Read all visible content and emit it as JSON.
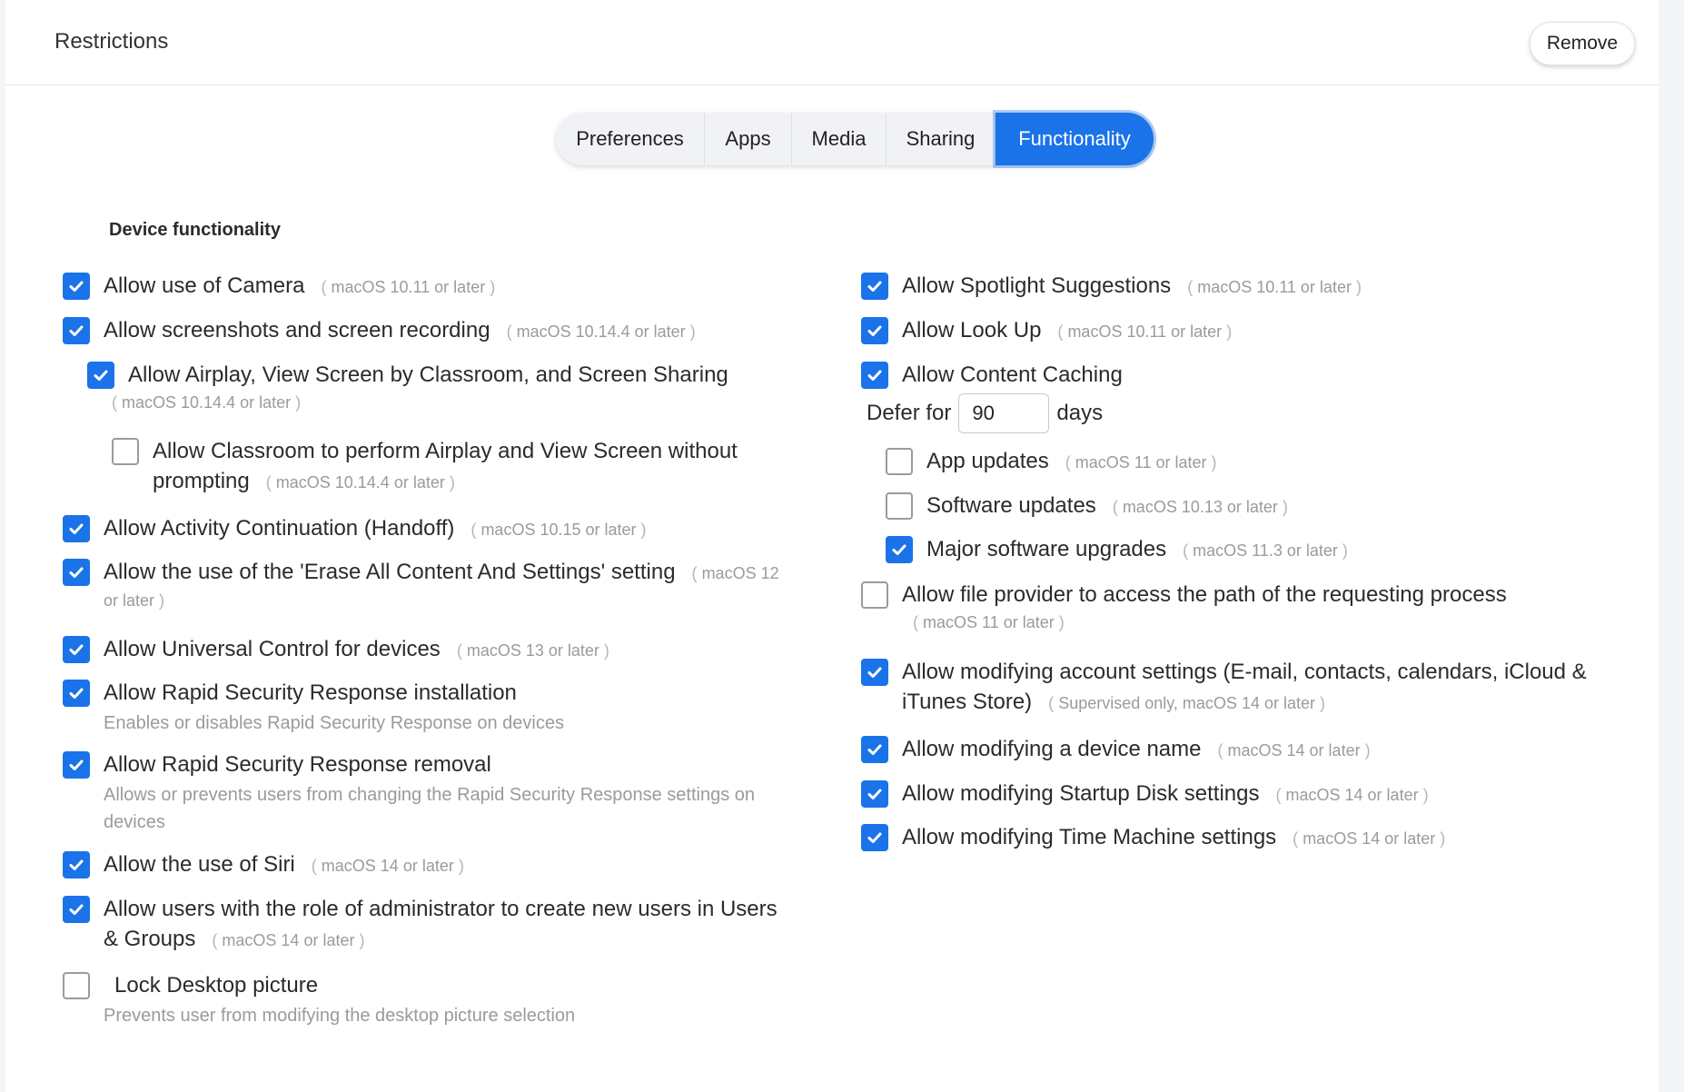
{
  "header": {
    "title": "Restrictions",
    "remove_label": "Remove"
  },
  "tabs": [
    "Preferences",
    "Apps",
    "Media",
    "Sharing",
    "Functionality"
  ],
  "active_tab": "Functionality",
  "section_title": "Device functionality",
  "left": {
    "camera": {
      "label": "Allow use of Camera",
      "req": "macOS 10.11 or later",
      "checked": true
    },
    "screenshots": {
      "label": "Allow screenshots and screen recording",
      "req": "macOS 10.14.4 or later",
      "checked": true
    },
    "airplay": {
      "label": "Allow Airplay, View Screen by Classroom, and Screen Sharing",
      "req": "macOS 10.14.4 or later",
      "checked": true
    },
    "classroom": {
      "label_line1": "Allow Classroom to perform Airplay and View Screen without",
      "label_line2": "prompting",
      "req": "macOS 10.14.4 or later",
      "checked": false
    },
    "handoff": {
      "label": "Allow Activity Continuation (Handoff)",
      "req": "macOS 10.15 or later",
      "checked": true
    },
    "erase": {
      "label": "Allow the use of the 'Erase All Content And Settings' setting",
      "req_part1": "macOS 12",
      "req_part2": "or later",
      "checked": true
    },
    "universal": {
      "label": "Allow Universal Control for devices",
      "req": "macOS 13 or later",
      "checked": true
    },
    "rsr_install": {
      "label": "Allow Rapid Security Response installation",
      "desc": "Enables or disables Rapid Security Response on devices",
      "checked": true
    },
    "rsr_removal": {
      "label": "Allow Rapid Security Response removal",
      "desc_line1": "Allows or prevents users from changing the Rapid Security Response settings on",
      "desc_line2": "devices",
      "checked": true
    },
    "siri": {
      "label": "Allow the use of Siri",
      "req": "macOS 14 or later",
      "checked": true
    },
    "admin_users": {
      "label_line1": "Allow users with the role of administrator to create new users in Users",
      "label_line2": "& Groups",
      "req": "macOS 14 or later",
      "checked": true
    },
    "desktop": {
      "label": "Lock Desktop picture",
      "desc": "Prevents user from modifying the desktop picture selection",
      "checked": false
    }
  },
  "right": {
    "spotlight": {
      "label": "Allow Spotlight Suggestions",
      "req": "macOS 10.11 or later",
      "checked": true
    },
    "lookup": {
      "label": "Allow Look Up",
      "req": "macOS 10.11 or later",
      "checked": true
    },
    "caching": {
      "label": "Allow Content Caching",
      "checked": true
    },
    "defer": {
      "prefix": "Defer for",
      "value": "90",
      "suffix": "days"
    },
    "app_updates": {
      "label": "App updates",
      "req": "macOS 11 or later",
      "checked": false
    },
    "software_updates": {
      "label": "Software updates",
      "req": "macOS 10.13 or later",
      "checked": false
    },
    "major_upgrades": {
      "label": "Major software upgrades",
      "req": "macOS 11.3 or later",
      "checked": true
    },
    "file_provider": {
      "label": "Allow file provider to access the path of the requesting process",
      "req": "macOS 11 or later",
      "checked": false
    },
    "account_settings": {
      "label_line1": "Allow modifying account settings (E-mail, contacts, calendars, iCloud &",
      "label_line2": "iTunes Store)",
      "req": "Supervised only, macOS 14 or later",
      "checked": true
    },
    "device_name": {
      "label": "Allow modifying a device name",
      "req": "macOS 14 or later",
      "checked": true
    },
    "startup_disk": {
      "label": "Allow modifying Startup Disk settings",
      "req": "macOS 14 or later",
      "checked": true
    },
    "time_machine": {
      "label": "Allow modifying Time Machine settings",
      "req": "macOS 14 or later",
      "checked": true
    }
  },
  "colors": {
    "accent": "#1a73e8",
    "muted": "#9a9aa0"
  }
}
